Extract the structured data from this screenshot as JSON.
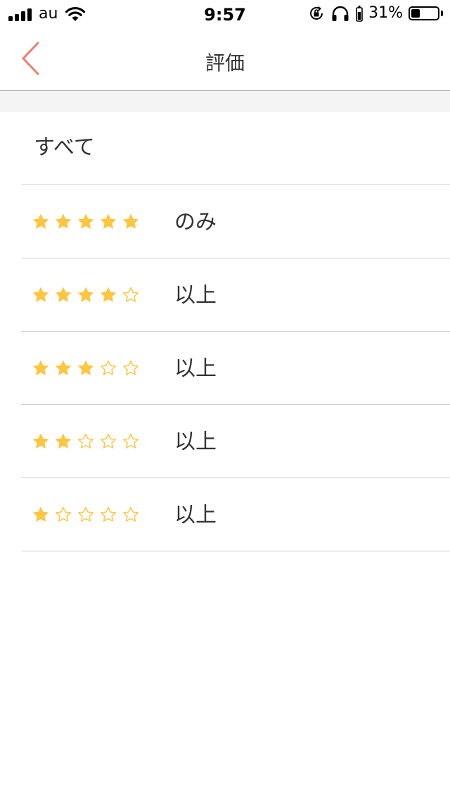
{
  "status_bar": {
    "carrier": "au",
    "time": "9:57",
    "battery_percent": "31%",
    "battery_level": 0.31
  },
  "nav": {
    "title": "評価",
    "back_icon": "chevron-left-icon"
  },
  "colors": {
    "accent": "#f07b6c",
    "star": "#fec540",
    "divider": "#cfcfcf"
  },
  "filter_options": [
    {
      "label": "すべて",
      "stars": null
    },
    {
      "label": "のみ",
      "stars": 5
    },
    {
      "label": "以上",
      "stars": 4
    },
    {
      "label": "以上",
      "stars": 3
    },
    {
      "label": "以上",
      "stars": 2
    },
    {
      "label": "以上",
      "stars": 1
    }
  ]
}
